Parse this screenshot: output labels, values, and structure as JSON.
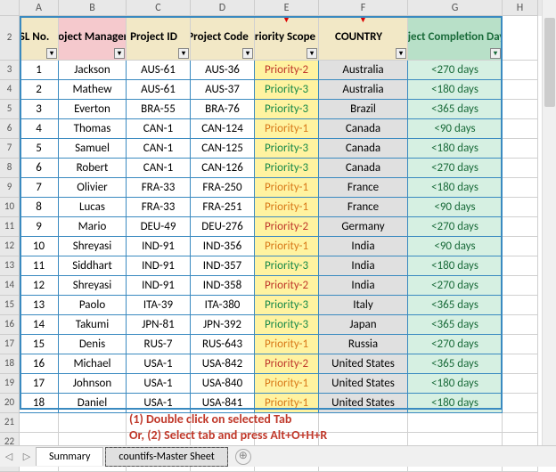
{
  "columns": [
    "A",
    "B",
    "C",
    "D",
    "E",
    "F",
    "G",
    "H"
  ],
  "headers": {
    "sl": "SL No.",
    "pm": "Project Manager",
    "pid": "Project ID",
    "pcode": "Project Code",
    "scope": "Priority Scope",
    "country": "COUNTRY",
    "days": "Project Completion Days"
  },
  "rows": [
    {
      "n": "1",
      "pm": "Jackson",
      "pid": "AUS-61",
      "pc": "AUS-36",
      "pr": "Priority-2",
      "prc": "p2",
      "co": "Australia",
      "d": "<270 days"
    },
    {
      "n": "2",
      "pm": "Mathew",
      "pid": "AUS-61",
      "pc": "AUS-37",
      "pr": "Priority-3",
      "prc": "p3",
      "co": "Australia",
      "d": "<180 days"
    },
    {
      "n": "3",
      "pm": "Everton",
      "pid": "BRA-55",
      "pc": "BRA-76",
      "pr": "Priority-3",
      "prc": "p3",
      "co": "Brazil",
      "d": "<365 days"
    },
    {
      "n": "4",
      "pm": "Thomas",
      "pid": "CAN-1",
      "pc": "CAN-124",
      "pr": "Priority-1",
      "prc": "p1",
      "co": "Canada",
      "d": "<90 days"
    },
    {
      "n": "5",
      "pm": "Samuel",
      "pid": "CAN-1",
      "pc": "CAN-125",
      "pr": "Priority-3",
      "prc": "p3",
      "co": "Canada",
      "d": "<180 days"
    },
    {
      "n": "6",
      "pm": "Robert",
      "pid": "CAN-1",
      "pc": "CAN-126",
      "pr": "Priority-3",
      "prc": "p3",
      "co": "Canada",
      "d": "<270 days"
    },
    {
      "n": "7",
      "pm": "Olivier",
      "pid": "FRA-33",
      "pc": "FRA-250",
      "pr": "Priority-1",
      "prc": "p1",
      "co": "France",
      "d": "<180 days"
    },
    {
      "n": "8",
      "pm": "Lucas",
      "pid": "FRA-33",
      "pc": "FRA-251",
      "pr": "Priority-1",
      "prc": "p1",
      "co": "France",
      "d": "<90 days"
    },
    {
      "n": "9",
      "pm": "Mario",
      "pid": "DEU-49",
      "pc": "DEU-276",
      "pr": "Priority-2",
      "prc": "p2",
      "co": "Germany",
      "d": "<270 days"
    },
    {
      "n": "10",
      "pm": "Shreyasi",
      "pid": "IND-91",
      "pc": "IND-356",
      "pr": "Priority-1",
      "prc": "p1",
      "co": "India",
      "d": "<90 days"
    },
    {
      "n": "11",
      "pm": "Siddhart",
      "pid": "IND-91",
      "pc": "IND-357",
      "pr": "Priority-3",
      "prc": "p3",
      "co": "India",
      "d": "<180 days"
    },
    {
      "n": "12",
      "pm": "Shreyasi",
      "pid": "IND-91",
      "pc": "IND-358",
      "pr": "Priority-2",
      "prc": "p2",
      "co": "India",
      "d": "<270 days"
    },
    {
      "n": "13",
      "pm": "Paolo",
      "pid": "ITA-39",
      "pc": "ITA-380",
      "pr": "Priority-3",
      "prc": "p3",
      "co": "Italy",
      "d": "<365 days"
    },
    {
      "n": "14",
      "pm": "Takumi",
      "pid": "JPN-81",
      "pc": "JPN-392",
      "pr": "Priority-3",
      "prc": "p3",
      "co": "Japan",
      "d": "<365 days"
    },
    {
      "n": "15",
      "pm": "Denis",
      "pid": "RUS-7",
      "pc": "RUS-643",
      "pr": "Priority-1",
      "prc": "p1",
      "co": "Russia",
      "d": "<270 days"
    },
    {
      "n": "16",
      "pm": "Michael",
      "pid": "USA-1",
      "pc": "USA-842",
      "pr": "Priority-2",
      "prc": "p2",
      "co": "United States",
      "d": "<365 days"
    },
    {
      "n": "17",
      "pm": "Johnson",
      "pid": "USA-1",
      "pc": "USA-840",
      "pr": "Priority-1",
      "prc": "p1",
      "co": "United States",
      "d": "<180 days"
    },
    {
      "n": "18",
      "pm": "Daniel",
      "pid": "USA-1",
      "pc": "USA-841",
      "pr": "Priority-1",
      "prc": "p1",
      "co": "United States",
      "d": "<180 days"
    }
  ],
  "note": {
    "line1": "(1) Double click on selected Tab",
    "line2": "Or, (2) Select tab and press Alt+O+H+R"
  },
  "tabs": {
    "summary": "Summary",
    "master": "countifs-Master Sheet"
  },
  "filter_glyph": "▾",
  "red_mark": "▼",
  "add_glyph": "⊕",
  "nav_prev": "◁",
  "nav_next": "▷"
}
